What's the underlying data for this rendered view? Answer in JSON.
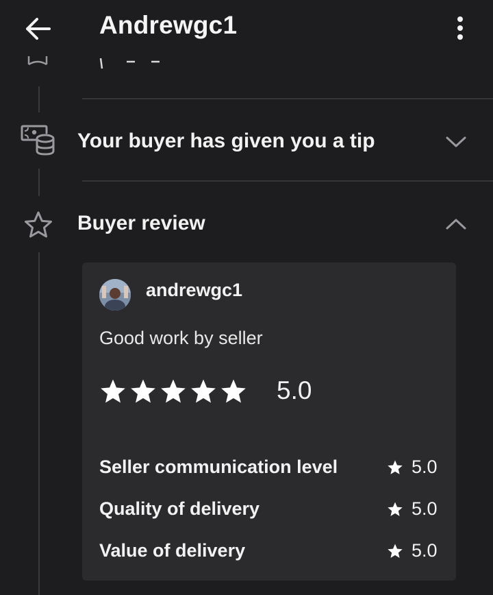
{
  "header": {
    "title": "Andrewgc1",
    "back_icon": "arrow-left-icon",
    "more_icon": "more-vertical-icon"
  },
  "timeline": {
    "items": [
      {
        "icon": "tip-coins-icon",
        "title": "Your buyer has given you a tip",
        "expanded": false
      },
      {
        "icon": "star-outline-icon",
        "title": "Buyer review",
        "expanded": true
      }
    ]
  },
  "review": {
    "reviewer": "andrewgc1",
    "comment": "Good work by seller",
    "rating": "5.0",
    "stars": 5,
    "categories": [
      {
        "label": "Seller communication level",
        "value": "5.0"
      },
      {
        "label": "Quality of delivery",
        "value": "5.0"
      },
      {
        "label": "Value of delivery",
        "value": "5.0"
      }
    ]
  },
  "colors": {
    "background": "#1d1d1f",
    "card": "#2b2b2e",
    "text": "#f2f2f2",
    "icon": "#9a9a9e",
    "divider": "#353537"
  }
}
